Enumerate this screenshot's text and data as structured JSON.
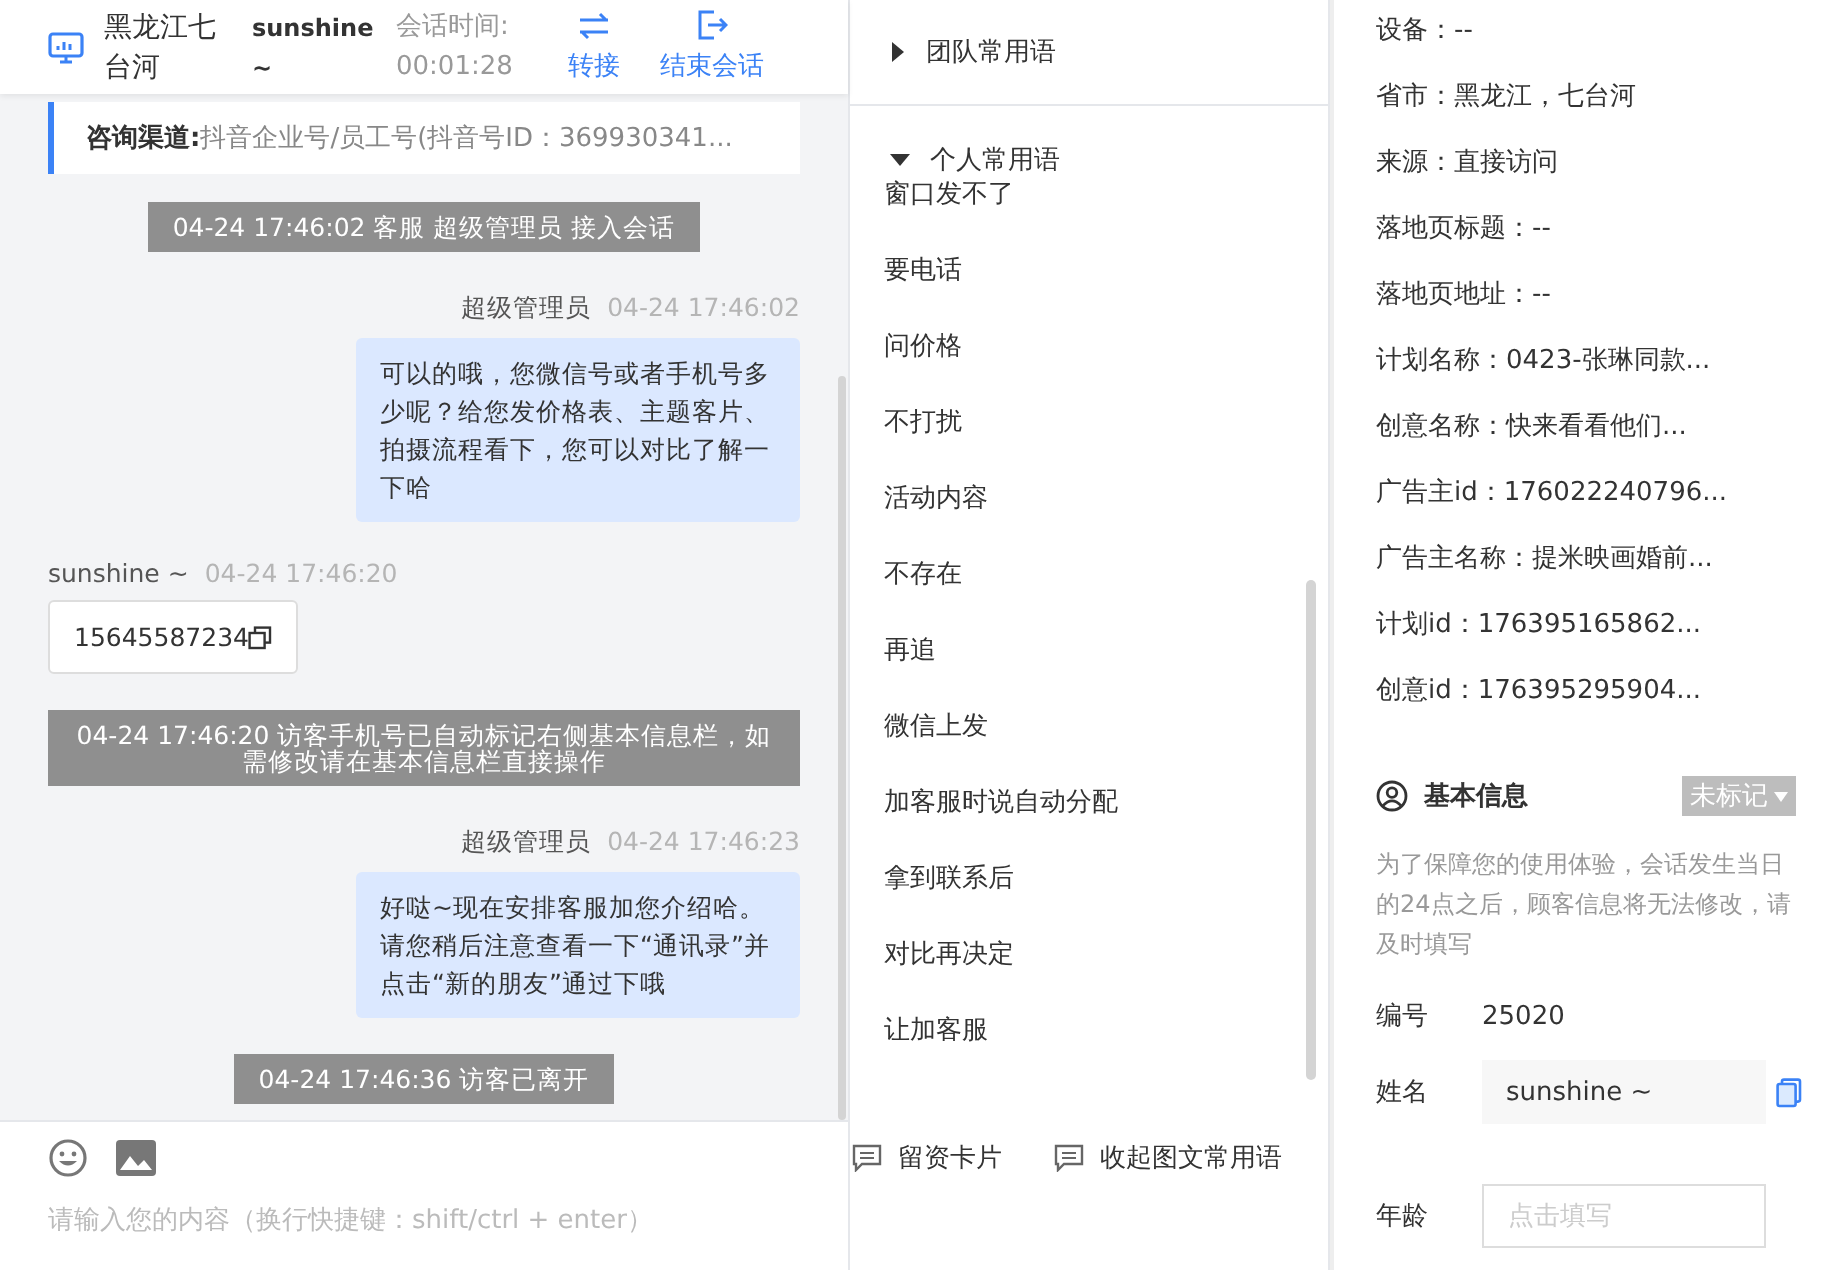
{
  "header": {
    "location": "黑龙江七台河",
    "visitor_name": "sunshine ~",
    "session_time_label": "会话时间:",
    "session_time": "00:01:28",
    "actions": [
      {
        "kind": "transfer",
        "label": "转接"
      },
      {
        "kind": "end",
        "label": "结束会话"
      }
    ]
  },
  "channel": {
    "label": "咨询渠道:",
    "value": "抖音企业号/员工号(抖音号ID：369930341..."
  },
  "messages": [
    {
      "kind": "system",
      "text": "04-24 17:46:02 客服 超级管理员 接入会话"
    },
    {
      "kind": "agent",
      "sender": "超级管理员",
      "time": "04-24 17:46:02",
      "text": "可以的哦，您微信号或者手机号多少呢？给您发价格表、主题客片、拍摄流程看下，您可以对比了解一下哈"
    },
    {
      "kind": "visitor",
      "sender": "sunshine ~",
      "time": "04-24 17:46:20",
      "text": "15645587234"
    },
    {
      "kind": "system",
      "text": "04-24 17:46:20 访客手机号已自动标记右侧基本信息栏，如需修改请在基本信息栏直接操作"
    },
    {
      "kind": "agent",
      "sender": "超级管理员",
      "time": "04-24 17:46:23",
      "text": "好哒~现在安排客服加您介绍哈。请您稍后注意查看一下“通讯录”并点击“新的朋友”通过下哦"
    },
    {
      "kind": "system",
      "text": "04-24 17:46:36 访客已离开"
    }
  ],
  "toolbar": {
    "tools": [
      {
        "kind": "emoji"
      },
      {
        "kind": "image"
      }
    ],
    "actions": [
      {
        "label": "留资卡片"
      },
      {
        "label": "收起图文常用语"
      }
    ]
  },
  "composer": {
    "placeholder": "请输入您的内容（换行快捷键：shift/ctrl + enter）"
  },
  "phrase_groups": [
    {
      "label": "团队常用语",
      "expanded": false
    },
    {
      "label": "个人常用语",
      "expanded": true,
      "items": [
        "窗口发不了",
        "要电话",
        "问价格",
        "不打扰",
        "活动内容",
        "不存在",
        "再追",
        "微信上发",
        "加客服时说自动分配",
        "拿到联系后",
        "对比再决定",
        "让加客服"
      ]
    }
  ],
  "details": [
    "设备：--",
    "省市：黑龙江，七台河",
    "来源：直接访问",
    "落地页标题：--",
    "落地页地址：--",
    "计划名称：0423-张琳同款...",
    "创意名称：快来看看他们...",
    "广告主id：176022240796...",
    "广告主名称：提米映画婚前...",
    "计划id：176395165862...",
    "创意id：176395295904..."
  ],
  "basic_info": {
    "title": "基本信息",
    "tag": "未标记",
    "notice": "为了保障您的使用体验，会话发生当日的24点之后，顾客信息将无法修改，请及时填写",
    "fields": [
      {
        "kind": "text",
        "label": "编号",
        "value": "25020"
      },
      {
        "kind": "input",
        "label": "姓名",
        "value": "sunshine ~",
        "copy": true
      },
      {
        "kind": "input",
        "label": "年龄",
        "placeholder": "点击填写",
        "copy": false
      }
    ]
  }
}
